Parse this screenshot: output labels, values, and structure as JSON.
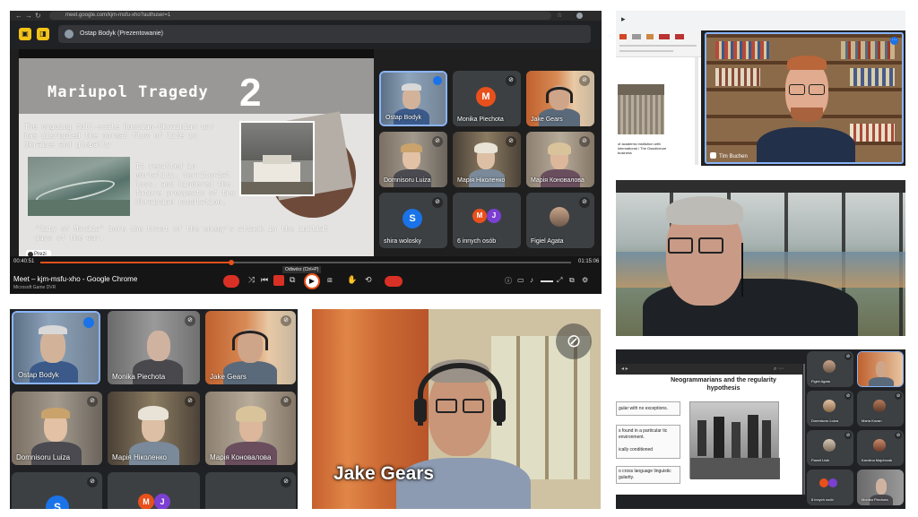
{
  "panel1": {
    "browser_url": "meet.google.com/kjm-msfu-xho?authuser=1",
    "presenter_chip": "Ostap Bodyk (Prezentowanie)",
    "slide": {
      "title": "Mariupol Tragedy",
      "number": "2",
      "para1": "The ongoing full-scale Russian-Ukrainian war has disrupted the normal flow of life in Ukraine and globally",
      "para2": "It resulted in mortality, territorial loss, and hindered the future prospects of the Ukrainian population.",
      "para3": "\"City of Mariia\" bore the brunt of the enemy's attack in the initial days of the war.",
      "prezi_label": "Prezi"
    },
    "tiles": [
      {
        "name": "Ostap Bodyk"
      },
      {
        "name": "Monika Piechota",
        "avatar": "M",
        "avatar_color": "#e8501c"
      },
      {
        "name": "Jake Gears"
      },
      {
        "name": "Domnisoru Luiza"
      },
      {
        "name": "Марія Ніколенко"
      },
      {
        "name": "Марія Коновалова"
      },
      {
        "name": "shira wolosky",
        "avatar": "S",
        "avatar_color": "#1a73e8"
      },
      {
        "name": "6 innych osób",
        "avatar1": "M",
        "avatar2": "J",
        "avatar1_color": "#e8501c",
        "avatar2_color": "#7b3fd1"
      },
      {
        "name": "Figiel Agata"
      }
    ],
    "player": {
      "time_elapsed": "00:40:51",
      "time_total": "01:15:06",
      "progress": 0.36,
      "tooltip": "Odtwórz (Ctrl+P)",
      "window_title": "Meet – kjm-msfu-xho - Google Chrome",
      "window_subtitle": "Microsoft Game DVR"
    }
  },
  "panel2": {
    "name": "Tim Buchen",
    "doc_text": "of academic institution with international / The Ossolineum business"
  },
  "panel4": {
    "tiles": [
      {
        "name": "Ostap Bodyk"
      },
      {
        "name": "Monika Piechota"
      },
      {
        "name": "Jake Gears"
      },
      {
        "name": "Domnisoru Luiza"
      },
      {
        "name": "Марія Ніколенко"
      },
      {
        "name": "Марія Коновалова"
      },
      {
        "avatar": "S",
        "avatar_color": "#1a73e8"
      },
      {
        "avatar1": "M",
        "avatar2": "J",
        "avatar1_color": "#e8501c",
        "avatar2_color": "#7b3fd1"
      },
      {}
    ]
  },
  "panel5": {
    "name": "Jake Gears"
  },
  "panel6": {
    "slide_title": "Neogrammarians and the regularity hypothesis",
    "bullets": [
      "gular with no exceptions.",
      "s found in a particular tic environment.",
      "ically conditioned",
      "o cross language linguistic gularity."
    ],
    "tiles": [
      {
        "name": "Figiel Agata"
      },
      {
        "name": ""
      },
      {
        "name": "Domnisoru Luiza"
      },
      {
        "name": "Maria Kozan"
      },
      {
        "name": "Paweł Lisik"
      },
      {
        "name": "Karolina Majchrzak"
      },
      {
        "name": "8 innych osób"
      },
      {
        "name": "Monika Piechota"
      }
    ]
  },
  "colors": {
    "meet_dark": "#202124",
    "tile": "#3c4043",
    "accent_blue": "#1a73e8",
    "slide_bg": "#e5e3e1",
    "end_call_red": "#d93025"
  }
}
